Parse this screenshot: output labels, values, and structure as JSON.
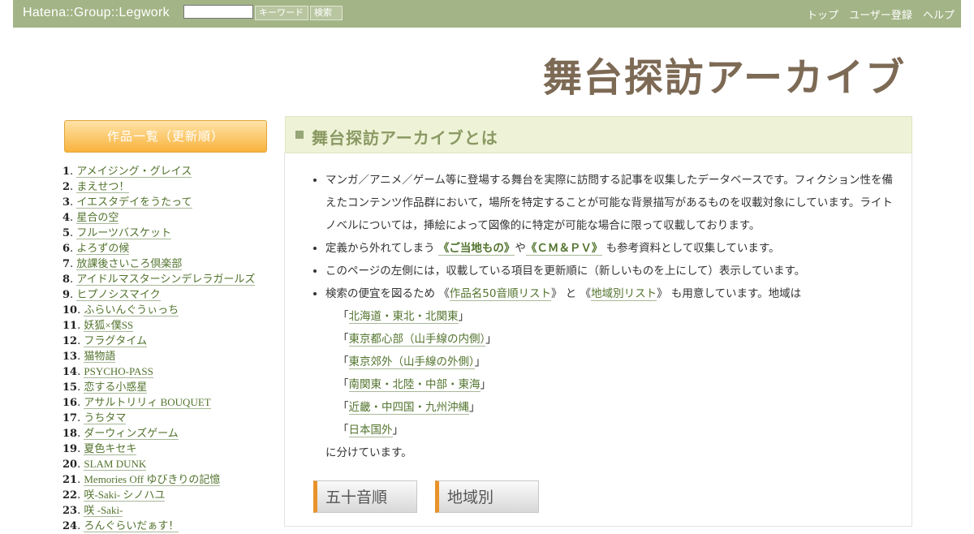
{
  "topbar": {
    "brand": "Hatena::Group::Legwork",
    "search_value": "",
    "keyword_button": "キーワード",
    "search_button": "検索",
    "links": [
      "トップ",
      "ユーザー登録",
      "ヘルプ"
    ]
  },
  "logo": "舞台探訪アーカイブ",
  "sidebar": {
    "header": "作品一覧（更新順）",
    "items": [
      {
        "num": "1",
        "title": "アメイジング・グレイス"
      },
      {
        "num": "2",
        "title": "まえせつ！"
      },
      {
        "num": "3",
        "title": "イエスタデイをうたって"
      },
      {
        "num": "4",
        "title": "星合の空"
      },
      {
        "num": "5",
        "title": "フルーツバスケット"
      },
      {
        "num": "6",
        "title": "よろずの候"
      },
      {
        "num": "7",
        "title": "放課後さいころ倶楽部"
      },
      {
        "num": "8",
        "title": "アイドルマスターシンデレラガールズ"
      },
      {
        "num": "9",
        "title": "ヒプノシスマイク"
      },
      {
        "num": "10",
        "title": "ふらいんぐうぃっち"
      },
      {
        "num": "11",
        "title": "妖狐×僕SS"
      },
      {
        "num": "12",
        "title": "フラグタイム"
      },
      {
        "num": "13",
        "title": "猫物語"
      },
      {
        "num": "14",
        "title": "PSYCHO-PASS"
      },
      {
        "num": "15",
        "title": "恋する小惑星"
      },
      {
        "num": "16",
        "title": "アサルトリリィ BOUQUET"
      },
      {
        "num": "17",
        "title": "うちタマ"
      },
      {
        "num": "18",
        "title": "ダーウィンズゲーム"
      },
      {
        "num": "19",
        "title": "夏色キセキ"
      },
      {
        "num": "20",
        "title": "SLAM DUNK"
      },
      {
        "num": "21",
        "title": "Memories Off ゆびきりの記憶"
      },
      {
        "num": "22",
        "title": "咲-Saki- シノハユ"
      },
      {
        "num": "23",
        "title": "咲 -Saki-"
      },
      {
        "num": "24",
        "title": "ろんぐらいだぁす！"
      }
    ]
  },
  "main": {
    "title": "舞台探訪アーカイブとは",
    "para1": "マンガ／アニメ／ゲーム等に登場する舞台を実際に訪問する記事を収集したデータベースです。フィクション性を備えたコンテンツ作品群において，場所を特定することが可能な背景描写があるものを収載対象にしています。ライトノベルについては，挿絵によって図像的に特定が可能な場合に限って収載しております。",
    "para2_pre": "定義から外れてしまう ",
    "para2_link1": "《ご当地もの》",
    "para2_mid": "や",
    "para2_link2": "《ＣＭ＆ＰＶ》",
    "para2_post": " も参考資料として収集しています。",
    "para3": "このページの左側には，収載している項目を更新順に（新しいものを上にして）表示しています。",
    "para4_pre": "検索の便宜を図るため 《",
    "para4_link1": "作品名50音順リスト",
    "para4_mid": "》 と 《",
    "para4_link2": "地域別リスト",
    "para4_post": "》 も用意しています。地域は",
    "regions": [
      "北海道・東北・北関東",
      "東京都心部（山手線の内側）",
      "東京郊外（山手線の外側）",
      "南関東・北陸・中部・東海",
      "近畿・中四国・九州沖縄",
      "日本国外"
    ],
    "region_open": "「",
    "region_close": "」",
    "para4_end": "に分けています。"
  },
  "buttons": {
    "gojuon": "五十音順",
    "region": "地域別"
  }
}
